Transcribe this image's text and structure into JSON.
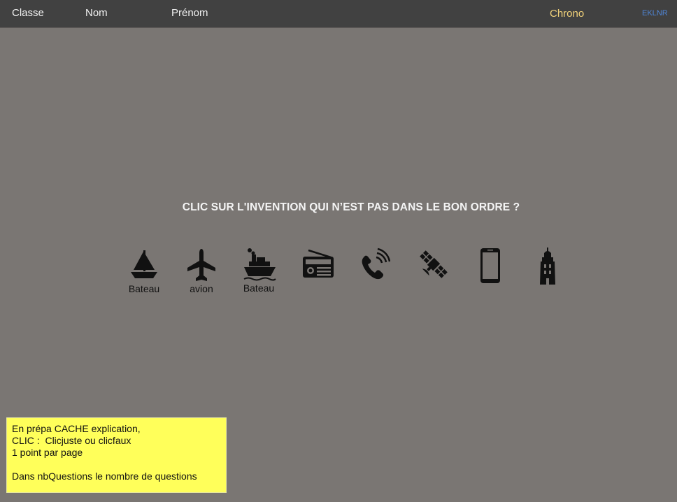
{
  "header": {
    "classe": "Classe",
    "nom": "Nom",
    "prenom": "Prénom",
    "chrono": "Chrono",
    "code": "EKLNR"
  },
  "question": "CLIC SUR L'INVENTION QUI N’EST PAS DANS LE BON ORDRE ?",
  "items": [
    {
      "icon": "sailboat-icon",
      "label": "Bateau"
    },
    {
      "icon": "airplane-icon",
      "label": "avion"
    },
    {
      "icon": "steamship-icon",
      "label": "Bateau"
    },
    {
      "icon": "radio-icon",
      "label": ""
    },
    {
      "icon": "phone-call-icon",
      "label": ""
    },
    {
      "icon": "satellite-icon",
      "label": ""
    },
    {
      "icon": "smartphone-icon",
      "label": ""
    },
    {
      "icon": "lighthouse-icon",
      "label": ""
    }
  ],
  "note": {
    "lines": [
      "En prépa CACHE explication,",
      "CLIC :  Clicjuste ou clicfaux",
      "1 point par page",
      "",
      "Dans nbQuestions le nombre de questions"
    ]
  },
  "colors": {
    "background": "#7a7673",
    "topbar": "#414141",
    "chrono": "#f2d27a",
    "code": "#4f86d8",
    "note": "#ffff5a"
  }
}
